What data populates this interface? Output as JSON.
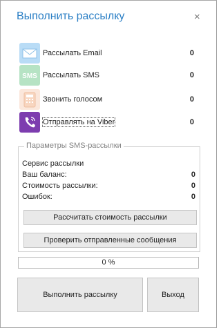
{
  "dialog": {
    "title": "Выполнить рассылку",
    "close_glyph": "×"
  },
  "options": [
    {
      "icon": "email-icon",
      "label": "Рассылать Email",
      "count": "0"
    },
    {
      "icon": "sms-icon",
      "label": "Рассылать SMS",
      "count": "0"
    },
    {
      "icon": "phone-icon",
      "label": "Звонить голосом",
      "count": "0"
    },
    {
      "icon": "viber-icon",
      "label": "Отправлять на Viber",
      "count": "0"
    }
  ],
  "sms": {
    "group_title": "Параметры SMS-рассылки",
    "service_label": "Сервис рассылки",
    "balance_label": "Ваш баланс:",
    "balance_value": "0",
    "cost_label": "Стоимость рассылки:",
    "cost_value": "0",
    "errors_label": "Ошибок:",
    "errors_value": "0",
    "calc_button": "Рассчитать стоимость рассылки",
    "check_button": "Проверить отправленные сообщения"
  },
  "progress": {
    "text": "0 %",
    "fraction": 0
  },
  "footer": {
    "run_button": "Выполнить рассылку",
    "exit_button": "Выход"
  },
  "colors": {
    "title": "#2b7fc5",
    "email": "#b9dcf6",
    "sms": "#b6e3c4",
    "phone": "#f8d6c0",
    "viber": "#7d3daf"
  }
}
